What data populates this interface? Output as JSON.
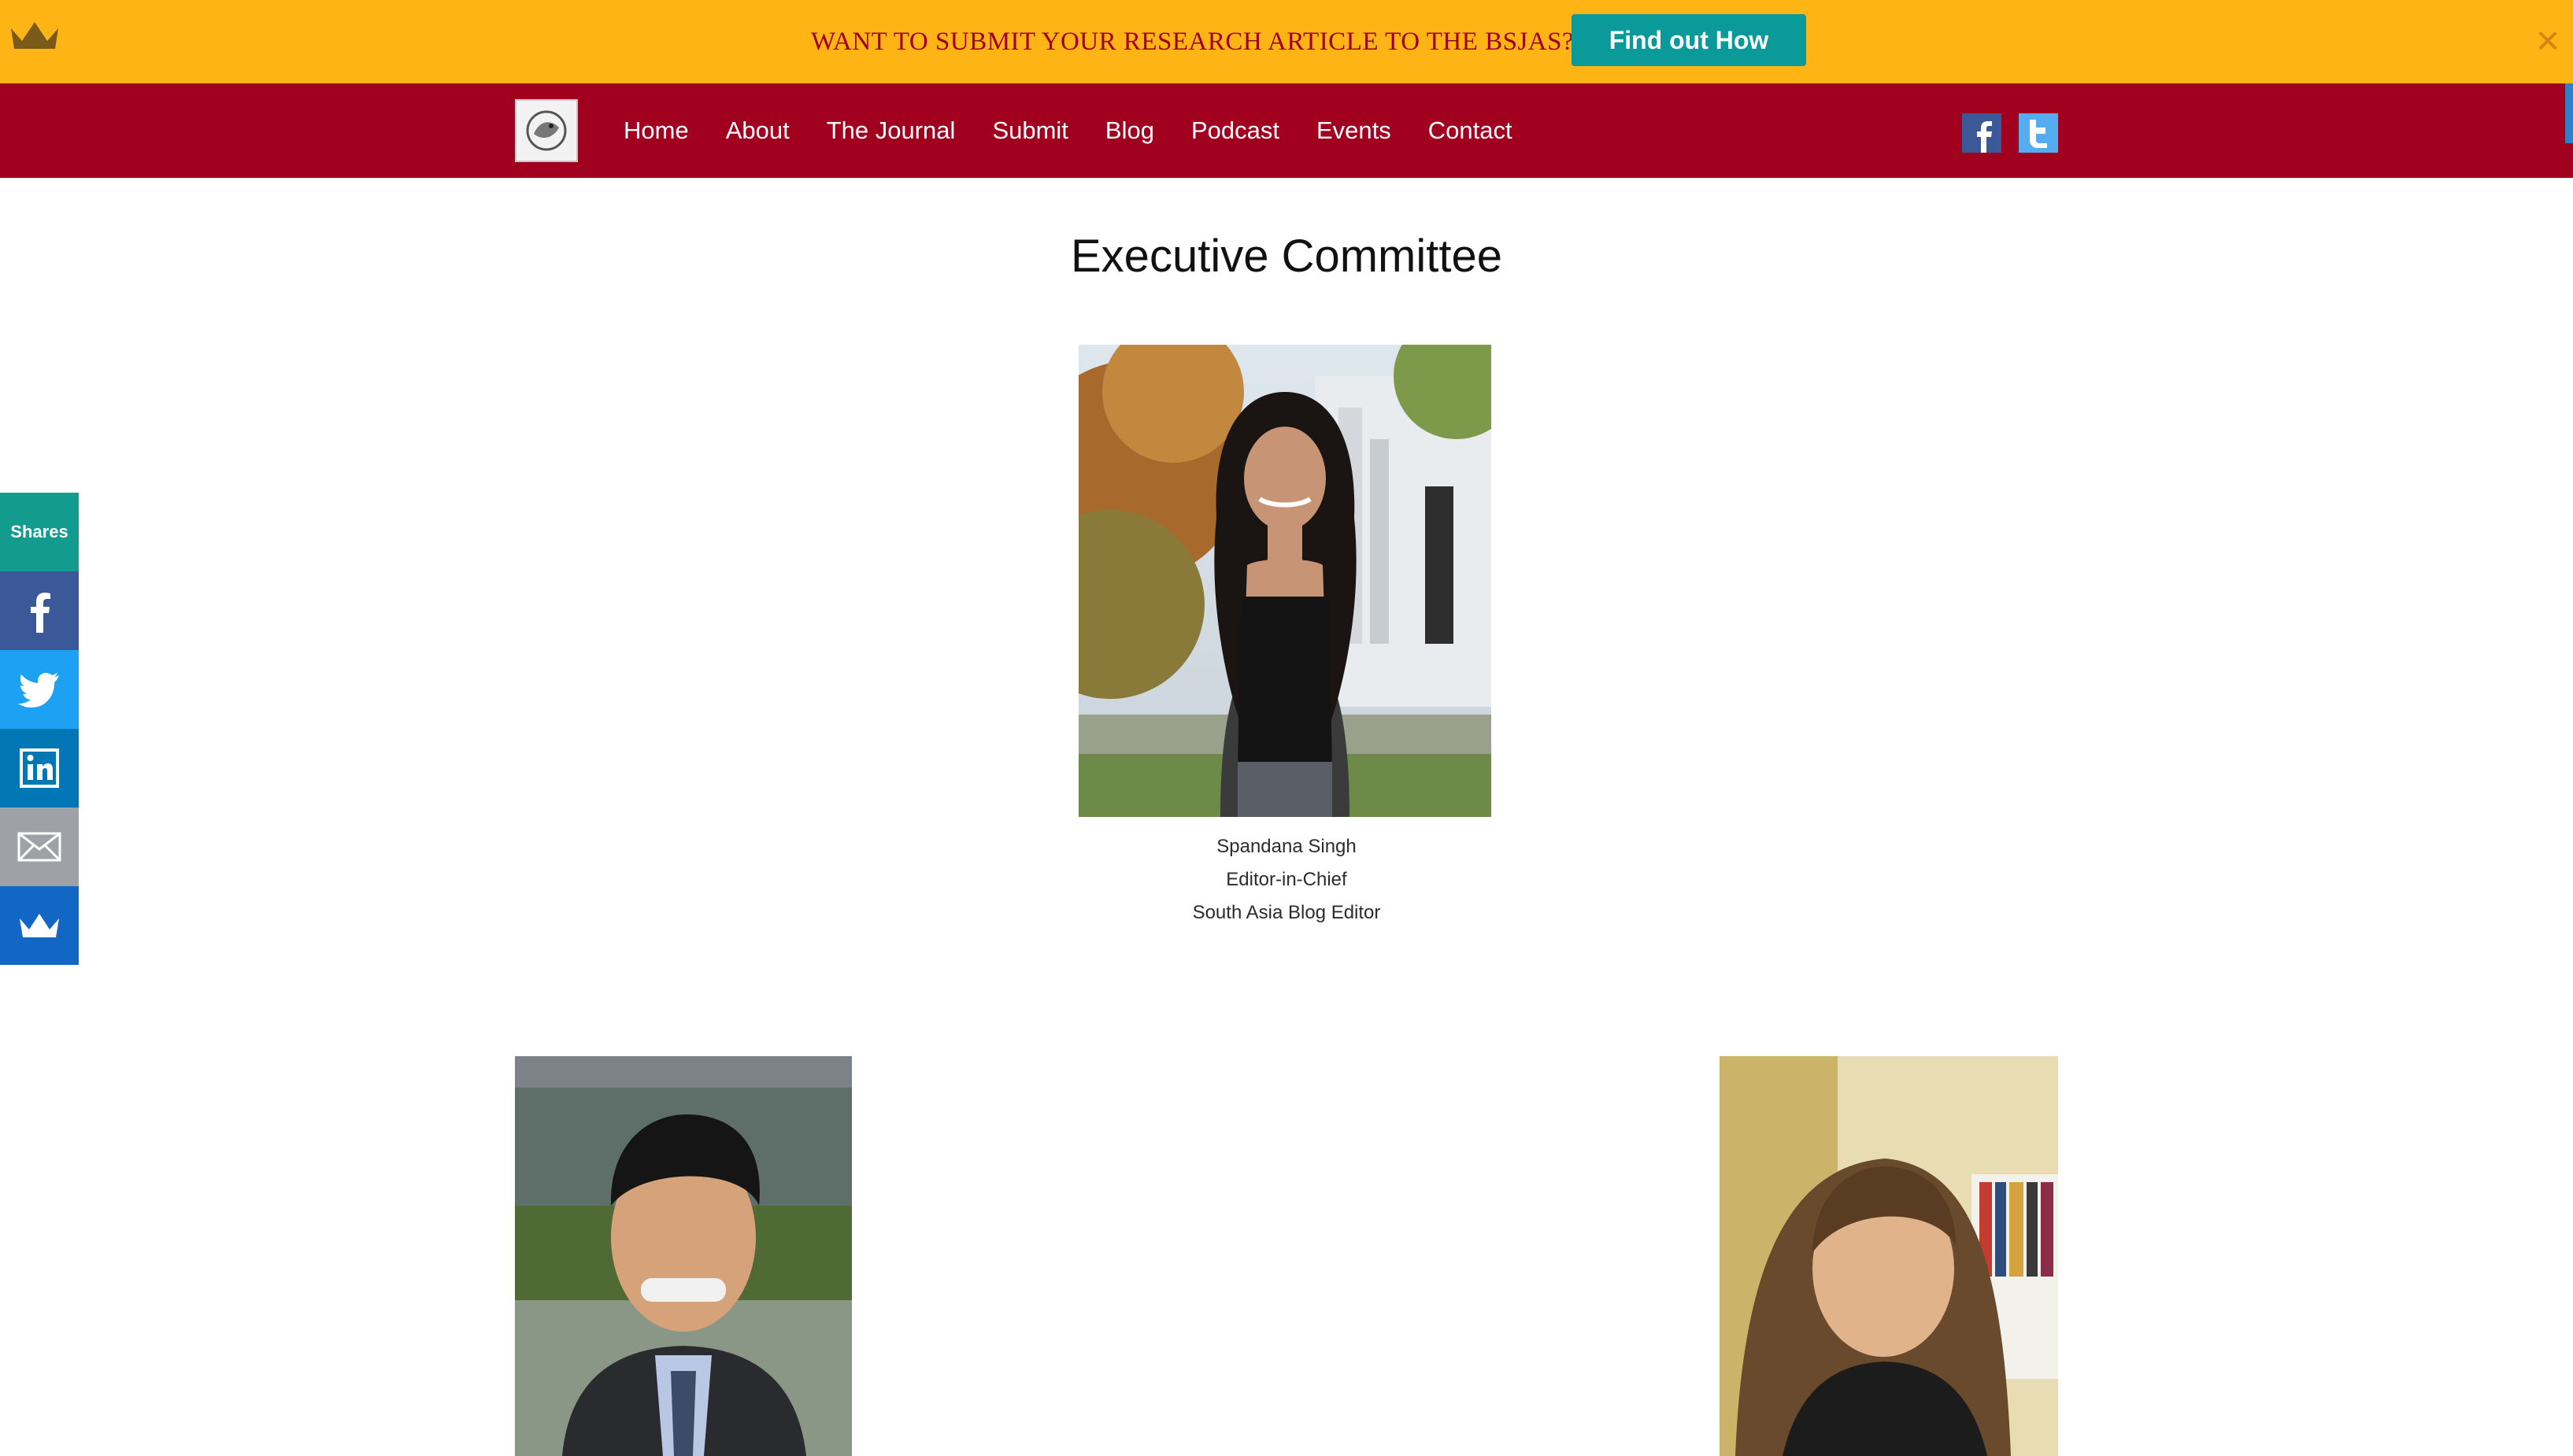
{
  "promo": {
    "text": "WANT TO SUBMIT YOUR RESEARCH ARTICLE TO THE BSJAS?",
    "cta_label": "Find out How",
    "close_glyph": "×",
    "crown_icon": "crown-icon"
  },
  "nav": {
    "items": [
      {
        "label": "Home"
      },
      {
        "label": "About"
      },
      {
        "label": "The Journal"
      },
      {
        "label": "Submit"
      },
      {
        "label": "Blog"
      },
      {
        "label": "Podcast"
      },
      {
        "label": "Events"
      },
      {
        "label": "Contact"
      }
    ],
    "colors": {
      "bar": "#a1001e",
      "promo": "#fdb414",
      "cta": "#0a9a9a"
    }
  },
  "share_rail": {
    "label": "Shares",
    "buttons": [
      "facebook-icon",
      "twitter-icon",
      "linkedin-icon",
      "email-icon",
      "sumo-crown-icon"
    ]
  },
  "page": {
    "title": "Executive Committee",
    "members": [
      {
        "name": "Spandana Singh",
        "roles": [
          "Editor-in-Chief",
          "South Asia Blog Editor"
        ]
      }
    ]
  }
}
